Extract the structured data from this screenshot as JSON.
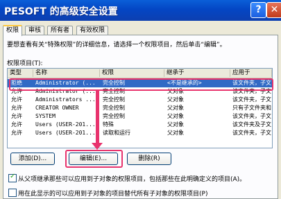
{
  "window": {
    "title": "PESOFT 的高级安全设置",
    "help_glyph": "?",
    "close_glyph": "✕"
  },
  "tabs": [
    {
      "label": "权限",
      "active": true
    },
    {
      "label": "审核",
      "active": false
    },
    {
      "label": "所有者",
      "active": false
    },
    {
      "label": "有效权限",
      "active": false
    }
  ],
  "description": "要想查看有关“特殊权限”的详细信息，请选择一个权限项目，然后单击“编辑”。",
  "list_label": "权限项目(T):",
  "columns": [
    "类型",
    "名称",
    "权限",
    "继承于",
    "应用于"
  ],
  "rows": [
    {
      "type": "拒绝",
      "name": "Administrator (...",
      "perm": "完全控制",
      "inherit": "<不是继承的>",
      "apply": "该文件夹，子文件...",
      "selected": true
    },
    {
      "type": "允许",
      "name": "Administrator (...",
      "perm": "完全控制",
      "inherit": "父对象",
      "apply": "该文件夹，子文件...",
      "selected": false
    },
    {
      "type": "允许",
      "name": "Administrators ...",
      "perm": "完全控制",
      "inherit": "父对象",
      "apply": "该文件夹，子文件...",
      "selected": false
    },
    {
      "type": "允许",
      "name": "CREATOR OWNER",
      "perm": "完全控制",
      "inherit": "父对象",
      "apply": "只有子文件夹和文件",
      "selected": false
    },
    {
      "type": "允许",
      "name": "SYSTEM",
      "perm": "完全控制",
      "inherit": "父对象",
      "apply": "该文件夹，子文件...",
      "selected": false
    },
    {
      "type": "允许",
      "name": "Users (USER-201...",
      "perm": "特殊",
      "inherit": "父对象",
      "apply": "该文件夹及子文件夹",
      "selected": false
    },
    {
      "type": "允许",
      "name": "Users (USER-201...",
      "perm": "读取和运行",
      "inherit": "父对象",
      "apply": "该文件夹，子文件...",
      "selected": false
    }
  ],
  "buttons": {
    "add": "添加(D)...",
    "edit": "编辑(E)...",
    "remove": "删除(R)"
  },
  "checkboxes": [
    {
      "label": "从父项继承那些可以应用到子对象的权限项目，包括那些在此明确定义的项目(A)。",
      "checked": true
    },
    {
      "label": "用在此显示的可以应用到子对象的项目替代所有子对象的权限项目(P)",
      "checked": false
    }
  ],
  "colors": {
    "highlight": "#e8336d",
    "selection": "#316ac5",
    "titlebar": "#0446c4"
  }
}
